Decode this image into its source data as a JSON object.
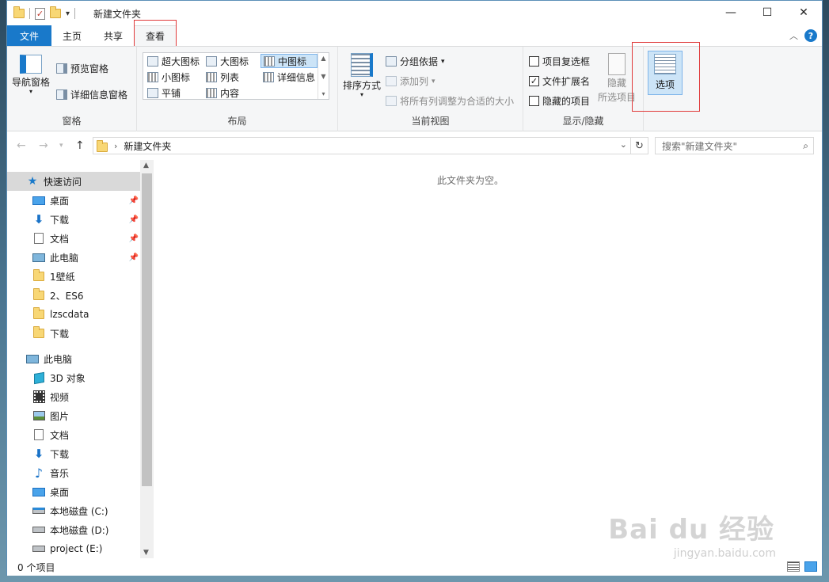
{
  "window": {
    "title": "新建文件夹"
  },
  "tabs": [
    {
      "label": "文件"
    },
    {
      "label": "主页"
    },
    {
      "label": "共享"
    },
    {
      "label": "查看"
    }
  ],
  "ribbon": {
    "pane_group": {
      "label": "窗格",
      "nav_pane": "导航窗格",
      "preview_pane": "预览窗格",
      "details_pane": "详细信息窗格"
    },
    "layout_group": {
      "label": "布局",
      "items": [
        "超大图标",
        "大图标",
        "中图标",
        "小图标",
        "列表",
        "详细信息",
        "平铺",
        "内容"
      ],
      "selected": "中图标"
    },
    "current_view_group": {
      "label": "当前视图",
      "sort_by": "排序方式",
      "group_by": "分组依据",
      "add_column": "添加列",
      "fit_columns": "将所有列调整为合适的大小"
    },
    "show_hide_group": {
      "label": "显示/隐藏",
      "item_checkboxes": {
        "label": "项目复选框",
        "checked": false
      },
      "file_extensions": {
        "label": "文件扩展名",
        "checked": true
      },
      "hidden_items": {
        "label": "隐藏的项目",
        "checked": false
      },
      "hide_selected_line1": "隐藏",
      "hide_selected_line2": "所选项目"
    },
    "options": "选项"
  },
  "address": {
    "path": "新建文件夹",
    "search_placeholder": "搜索\"新建文件夹\""
  },
  "nav_pane": {
    "quick_access": "快速访问",
    "quick_items": [
      {
        "label": "桌面",
        "icon": "desktop-icon",
        "pinned": true
      },
      {
        "label": "下载",
        "icon": "download-icon",
        "pinned": true
      },
      {
        "label": "文档",
        "icon": "document-icon",
        "pinned": true
      },
      {
        "label": "此电脑",
        "icon": "computer-icon",
        "pinned": true
      },
      {
        "label": "1壁纸",
        "icon": "folder-icon",
        "pinned": false
      },
      {
        "label": "2、ES6",
        "icon": "folder-icon",
        "pinned": false
      },
      {
        "label": "lzscdata",
        "icon": "folder-icon",
        "pinned": false
      },
      {
        "label": "下载",
        "icon": "folder-icon",
        "pinned": false
      }
    ],
    "this_pc": "此电脑",
    "pc_items": [
      {
        "label": "3D 对象",
        "icon": "3d-objects-icon"
      },
      {
        "label": "视频",
        "icon": "video-icon"
      },
      {
        "label": "图片",
        "icon": "pictures-icon"
      },
      {
        "label": "文档",
        "icon": "document-icon"
      },
      {
        "label": "下载",
        "icon": "download-icon"
      },
      {
        "label": "音乐",
        "icon": "music-icon"
      },
      {
        "label": "桌面",
        "icon": "desktop-icon"
      },
      {
        "label": "本地磁盘 (C:)",
        "icon": "drive-c-icon"
      },
      {
        "label": "本地磁盘 (D:)",
        "icon": "drive-icon"
      },
      {
        "label": "project (E:)",
        "icon": "drive-icon"
      }
    ]
  },
  "content": {
    "empty_message": "此文件夹为空。"
  },
  "status": {
    "item_count": "0 个项目"
  },
  "watermark": {
    "brand": "Bai du 经验",
    "url": "jingyan.baidu.com"
  },
  "colors": {
    "accent": "#1979ca",
    "highlight": "#e03a3a",
    "selected": "#cce4f7"
  }
}
